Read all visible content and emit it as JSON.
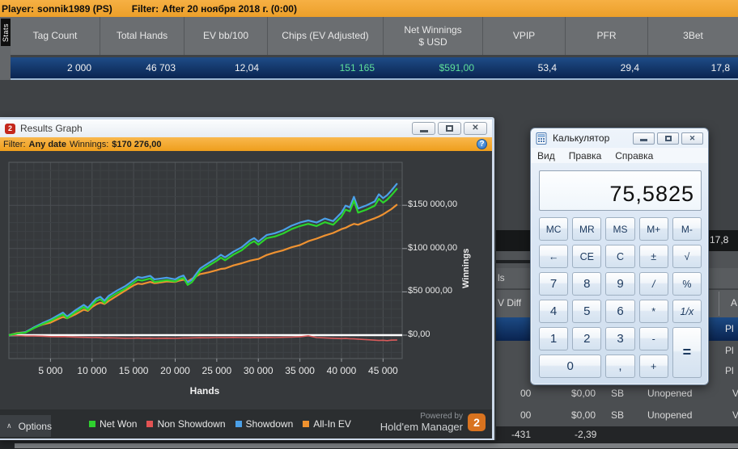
{
  "top_bar": {
    "player_label": "Player:",
    "player_value": "sonnik1989 (PS)",
    "filter_label": "Filter:",
    "filter_value": "After 20 ноября 2018 г. (0:00)"
  },
  "stats_tab_label": "Stats",
  "stats_table": {
    "columns": [
      "Tag Count",
      "Total Hands",
      "EV bb/100",
      "Chips (EV Adjusted)",
      "Net Winnings\n$ USD",
      "VPIP",
      "PFR",
      "3Bet"
    ],
    "row": [
      "2 000",
      "46 703",
      "12,04",
      "151 165",
      "$591,00",
      "53,4",
      "29,4",
      "17,8"
    ]
  },
  "graph_window": {
    "title": "Results Graph",
    "title_badge": "2",
    "filter_label": "Filter:",
    "filter_value": "Any date",
    "winnings_label": "Winnings:",
    "winnings_value": "$170 276,00",
    "help_icon": "?",
    "options_label": "Options",
    "options_chevron": "∧",
    "legend": [
      {
        "label": "Net Won",
        "color": "#2fd12f"
      },
      {
        "label": "Non Showdown",
        "color": "#e25353"
      },
      {
        "label": "Showdown",
        "color": "#4ba0e8"
      },
      {
        "label": "All-In EV",
        "color": "#f0922f"
      }
    ],
    "powered_by": "Powered by",
    "brand": "Hold'em Manager",
    "brand_badge": "2"
  },
  "chart_data": {
    "type": "line",
    "title": "Results Graph",
    "xlabel": "Hands",
    "ylabel": "Winnings",
    "xlim": [
      0,
      47300
    ],
    "ylim": [
      -27000,
      199000
    ],
    "grid": true,
    "legend_position": "bottom",
    "x_ticks": [
      5000,
      10000,
      15000,
      20000,
      25000,
      30000,
      35000,
      40000,
      45000
    ],
    "x_tick_labels": [
      "5 000",
      "10 000",
      "15 000",
      "20 000",
      "25 000",
      "30 000",
      "35 000",
      "40 000",
      "45 000"
    ],
    "y_ticks": [
      0,
      50000,
      100000,
      150000
    ],
    "y_tick_labels": [
      "$0,00",
      "$50 000,00",
      "$100 000,00",
      "$150 000,00"
    ],
    "zero_line_color": "#ffffff",
    "x": [
      0,
      1000,
      2000,
      3000,
      4000,
      5000,
      6000,
      6500,
      7000,
      8000,
      9000,
      9500,
      10000,
      10500,
      11000,
      11500,
      12000,
      13000,
      14000,
      15000,
      15500,
      16000,
      17000,
      17500,
      18000,
      19000,
      20000,
      20500,
      21000,
      21500,
      22000,
      23000,
      24000,
      25000,
      25500,
      26000,
      27000,
      28000,
      29000,
      29500,
      30000,
      31000,
      32000,
      33000,
      34000,
      35000,
      36000,
      37000,
      38000,
      39000,
      40000,
      40500,
      41000,
      41500,
      42000,
      43000,
      44000,
      44500,
      45000,
      45500,
      46000,
      46703
    ],
    "series": [
      {
        "name": "Net Won",
        "color": "#2cd42c",
        "values": [
          0,
          2000,
          3000,
          8000,
          12500,
          16500,
          21500,
          24000,
          19500,
          26500,
          32500,
          29000,
          34500,
          39500,
          41500,
          37000,
          42500,
          48500,
          53500,
          60500,
          64000,
          63000,
          65500,
          61500,
          62000,
          63500,
          62000,
          64500,
          66000,
          58000,
          61000,
          74000,
          80000,
          86000,
          89500,
          86500,
          93000,
          98000,
          106000,
          108500,
          104500,
          112000,
          114000,
          117500,
          122500,
          126000,
          128500,
          126000,
          130500,
          127500,
          137000,
          145000,
          143000,
          155000,
          141500,
          145000,
          149500,
          157500,
          153000,
          156500,
          161500,
          169500
        ]
      },
      {
        "name": "Non Showdown",
        "color": "#d95b5b",
        "values": [
          0,
          -500,
          -1000,
          -1000,
          -1200,
          -1700,
          -1800,
          -1700,
          -2000,
          -2200,
          -2500,
          -2600,
          -2800,
          -2700,
          -3000,
          -3300,
          -3100,
          -3400,
          -3600,
          -3500,
          -3400,
          -3600,
          -3500,
          -3700,
          -3600,
          -3500,
          -3700,
          -3500,
          -3300,
          -3400,
          -3200,
          -3000,
          -3100,
          -2800,
          -2700,
          -2900,
          -2600,
          -2800,
          -3000,
          -2700,
          -2900,
          -2600,
          -2800,
          -2500,
          -2300,
          -2000,
          -700,
          -2800,
          -3200,
          -3600,
          -4000,
          -3800,
          -4200,
          -4300,
          -4600,
          -5200,
          -5800,
          -6200,
          -5900,
          -6300,
          -5800,
          -5700
        ]
      },
      {
        "name": "Showdown",
        "color": "#4ba0e8",
        "values": [
          0,
          2000,
          3500,
          9000,
          13700,
          18000,
          23300,
          26000,
          21500,
          28700,
          35000,
          31500,
          37000,
          42200,
          44300,
          39800,
          45300,
          51500,
          56500,
          63500,
          67200,
          66200,
          68500,
          64500,
          65000,
          66300,
          64500,
          67200,
          68800,
          60800,
          63800,
          77000,
          83200,
          89200,
          92800,
          89800,
          96400,
          101500,
          109500,
          112000,
          108000,
          115600,
          117700,
          121300,
          126400,
          130000,
          132500,
          130000,
          134700,
          131700,
          141500,
          149600,
          147600,
          159800,
          146300,
          149800,
          154500,
          162700,
          158200,
          161800,
          167000,
          175300
        ]
      },
      {
        "name": "All-In EV",
        "color": "#ef9231",
        "values": [
          0,
          2500,
          3500,
          8500,
          12000,
          14500,
          19000,
          21000,
          19500,
          24000,
          29500,
          28000,
          32500,
          35500,
          37500,
          36000,
          39500,
          45500,
          51500,
          57500,
          59500,
          59000,
          61500,
          60000,
          60500,
          62000,
          61500,
          63000,
          64000,
          62000,
          65000,
          70500,
          72500,
          75000,
          76500,
          77000,
          80500,
          83000,
          86000,
          87000,
          88000,
          92500,
          95500,
          98000,
          101500,
          104000,
          108500,
          111500,
          115000,
          118000,
          122500,
          124000,
          126500,
          128500,
          127500,
          131500,
          135000,
          137000,
          139500,
          142500,
          145500,
          151000
        ]
      }
    ]
  },
  "calculator": {
    "title": "Калькулятор",
    "menu": [
      "Вид",
      "Правка",
      "Справка"
    ],
    "display": "75,5825",
    "keys": [
      {
        "label": "MC",
        "cls": "k-mem"
      },
      {
        "label": "MR",
        "cls": "k-mem"
      },
      {
        "label": "MS",
        "cls": "k-mem"
      },
      {
        "label": "M+",
        "cls": "k-mem"
      },
      {
        "label": "M-",
        "cls": "k-mem"
      },
      {
        "label": "←",
        "cls": "k-op"
      },
      {
        "label": "CE",
        "cls": "k-op"
      },
      {
        "label": "C",
        "cls": "k-op"
      },
      {
        "label": "±",
        "cls": "k-op"
      },
      {
        "label": "√",
        "cls": "k-op"
      },
      {
        "label": "7",
        "cls": "k-num"
      },
      {
        "label": "8",
        "cls": "k-num"
      },
      {
        "label": "9",
        "cls": "k-num"
      },
      {
        "label": "/",
        "cls": "k-op k-ital"
      },
      {
        "label": "%",
        "cls": "k-op"
      },
      {
        "label": "4",
        "cls": "k-num"
      },
      {
        "label": "5",
        "cls": "k-num"
      },
      {
        "label": "6",
        "cls": "k-num"
      },
      {
        "label": "*",
        "cls": "k-op"
      },
      {
        "label": "1/x",
        "cls": "k-op k-ital"
      },
      {
        "label": "1",
        "cls": "k-num"
      },
      {
        "label": "2",
        "cls": "k-num"
      },
      {
        "label": "3",
        "cls": "k-num"
      },
      {
        "label": "-",
        "cls": "k-op"
      },
      {
        "label": "=",
        "cls": "k-eq"
      },
      {
        "label": "0",
        "cls": "k-zero"
      },
      {
        "label": ",",
        "cls": "k-num"
      },
      {
        "label": "+",
        "cls": "k-op"
      }
    ]
  },
  "background_window": {
    "total_value": "17,8",
    "partial_hands_header": "ls",
    "col_ev_diff": "V Diff",
    "col_a": "A",
    "pl_selected": "Pl",
    "pl_row_1": "Pl",
    "pl_row_2": "Pl",
    "hand_rows": [
      {
        "c1": "00",
        "c2": "$0,00",
        "c3": "SB",
        "c4": "Unopened",
        "c5": "V"
      },
      {
        "c1": "00",
        "c2": "$0,00",
        "c3": "SB",
        "c4": "Unopened",
        "c5": "V"
      }
    ],
    "summary": {
      "v1": "-431",
      "v2": "-2,39"
    }
  }
}
